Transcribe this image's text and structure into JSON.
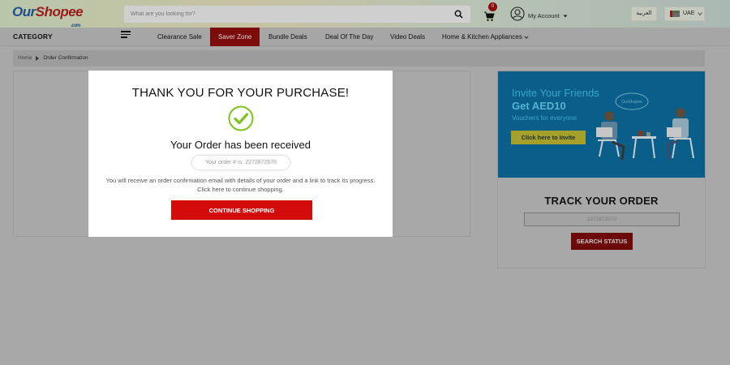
{
  "header": {
    "logo": {
      "part1": "Our",
      "part2": "Shopee",
      "suffix": ".com"
    },
    "search": {
      "placeholder": "What are you looking for?",
      "value": ""
    },
    "cart": {
      "count": "0"
    },
    "account": {
      "label": "My Account"
    },
    "language": "العربية",
    "region": "UAE"
  },
  "nav": {
    "category_label": "CATEGORY",
    "items": [
      {
        "label": "Clearance Sale"
      },
      {
        "label": "Saver Zone",
        "active": true
      },
      {
        "label": "Bundle Deals"
      },
      {
        "label": "Deal Of The Day"
      },
      {
        "label": "Video Deals"
      },
      {
        "label": "Home & Kitchen Appliances"
      }
    ]
  },
  "breadcrumb": {
    "home": "Home",
    "current": "Order Confirmation"
  },
  "modal": {
    "title": "THANK YOU FOR YOUR PURCHASE!",
    "received": "Your Order has been received",
    "order_label": "Your order # is:",
    "order_number": "2272872570",
    "message_line1": "You will receive an order confirmation email with details of your order and a link to track its progress.",
    "message_line2": "Click here to continue shopping.",
    "continue_label": "CONTINUE SHOPPING"
  },
  "sidebar": {
    "banner": {
      "line1": "Invite Your Friends",
      "line2": "Get AED10",
      "line3": "Vouchers for everyone",
      "cta": "Click here to Invite",
      "bubble_text": "OurShopee"
    },
    "track": {
      "title": "TRACK YOUR ORDER",
      "input_value": "2272872570",
      "button_label": "SEARCH STATUS"
    }
  },
  "colors": {
    "brand_red": "#d40b0b",
    "success_green": "#7dc31e",
    "banner_blue": "#0a5f8a"
  }
}
